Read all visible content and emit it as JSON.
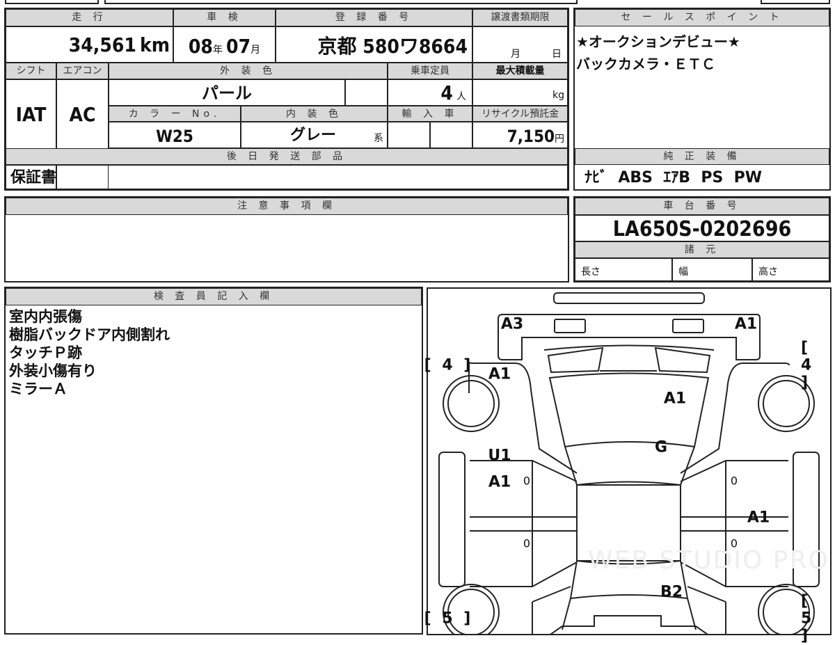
{
  "header_table": {
    "mileage_label": "走 行",
    "mileage_value": "34,561",
    "mileage_unit": "km",
    "inspection_label": "車 検",
    "inspection_year": "08",
    "year_unit": "年",
    "inspection_month": "07",
    "month_unit": "月",
    "registration_label": "登 録 番 号",
    "registration_value": "京都 580ワ8664",
    "transfer_deadline_label": "譲渡書類期限",
    "transfer_month_unit": "月",
    "transfer_day_unit": "日",
    "shift_label": "シフト",
    "shift_value": "IAT",
    "aircon_label": "エアコン",
    "aircon_value": "AC",
    "exterior_color_label": "外 装 色",
    "exterior_color_value": "パール",
    "capacity_label": "乗車定員",
    "capacity_value": "4",
    "capacity_unit": "人",
    "max_load_label": "最大積載量",
    "max_load_unit": "kg",
    "color_no_label": "カ ラ ー No.",
    "color_no_value": "W25",
    "interior_color_label": "内 装 色",
    "interior_color_value": "グレー",
    "interior_color_suffix": "系",
    "import_label": "輸 入 車",
    "recycle_label": "リサイクル預託金",
    "recycle_value": "7,150",
    "recycle_unit": "円",
    "later_parts_label": "後 日 発 送 部 品",
    "later_parts_value": "保証書"
  },
  "sales_points": {
    "label": "セ ー ル ス ポ イ ン ト",
    "lines": [
      "★オークションデビュー★",
      "バックカメラ・ＥＴＣ"
    ]
  },
  "genuine_equipment": {
    "label": "純 正 装 備",
    "value": "ﾅﾋﾞ  ABS  ｴｱB  PS  PW"
  },
  "notes": {
    "label": "注 意 事 項 欄",
    "value": ""
  },
  "chassis": {
    "label": "車 台 番 号",
    "value": "LA650S-0202696",
    "specs_label": "諸 元",
    "length_label": "長さ",
    "width_label": "幅",
    "height_label": "高さ"
  },
  "inspector": {
    "label": "検 査 員 記 入 欄",
    "lines": [
      "室内内張傷",
      "樹脂バックドア内側割れ",
      "タッチＰ跡",
      "外装小傷有り",
      "ミラーＡ"
    ]
  },
  "diagram": {
    "marks": [
      {
        "part": "front-bumper-left",
        "code": "A3"
      },
      {
        "part": "front-bumper-right",
        "code": "A1"
      },
      {
        "part": "front-fender-left",
        "code": "A1"
      },
      {
        "part": "hood",
        "code": "A1"
      },
      {
        "part": "windshield",
        "code": "G"
      },
      {
        "part": "front-door-left",
        "code": "U1"
      },
      {
        "part": "front-door-left-2",
        "code": "A1"
      },
      {
        "part": "rear-door-right",
        "code": "A1"
      },
      {
        "part": "back-door",
        "code": "B2"
      }
    ],
    "tread": {
      "front_left": "[ 4 ]",
      "front_right": "[ 4 ]",
      "rear_left": "[ 5 ]",
      "rear_right": "[ 5 ]"
    },
    "door_zero": "0",
    "watermark": "WEB STUDIO PRO"
  }
}
